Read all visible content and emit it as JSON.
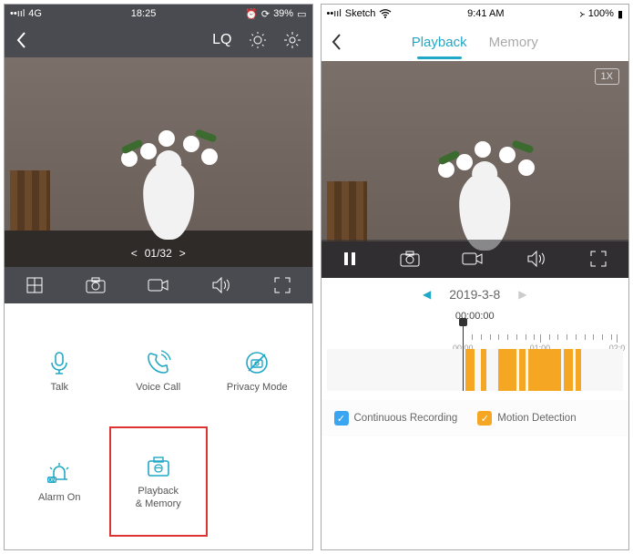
{
  "left": {
    "status": {
      "signal": "4G",
      "time": "18:25",
      "battery": "39%"
    },
    "topbar": {
      "quality": "LQ"
    },
    "pager": {
      "current": "01",
      "total": "32"
    },
    "actions": {
      "talk": "Talk",
      "voice_call": "Voice Call",
      "privacy": "Privacy Mode",
      "alarm": "Alarm On",
      "playback": "Playback\n& Memory"
    }
  },
  "right": {
    "status": {
      "signal": "Sketch",
      "time": "9:41 AM",
      "battery": "100%"
    },
    "tabs": {
      "playback": "Playback",
      "memory": "Memory"
    },
    "speed": "1X",
    "date": "2019-3-8",
    "timecode": "00:00:00",
    "ruler_labels": [
      "00:00",
      "01:00",
      "02:0"
    ],
    "legend": {
      "continuous": "Continuous Recording",
      "motion": "Motion Detection"
    }
  }
}
